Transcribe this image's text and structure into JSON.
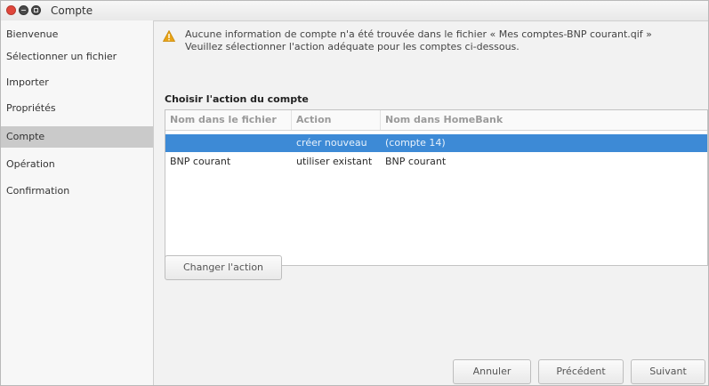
{
  "window": {
    "title": "Compte"
  },
  "sidebar": {
    "items": [
      {
        "label": "Bienvenue",
        "active": false
      },
      {
        "label": "Sélectionner un fichier",
        "active": false
      },
      {
        "label": "Importer",
        "active": false
      },
      {
        "label": "Propriétés",
        "active": false
      },
      {
        "label": "Compte",
        "active": true
      },
      {
        "label": "Opération",
        "active": false
      },
      {
        "label": "Confirmation",
        "active": false
      }
    ]
  },
  "warning": {
    "icon": "warning-icon",
    "line1": "Aucune information de compte n'a été trouvée dans le fichier « Mes comptes-BNP courant.qif »",
    "line2": "Veuillez sélectionner l'action adéquate pour les comptes ci-dessous."
  },
  "section": {
    "title": "Choisir l'action du compte"
  },
  "table": {
    "columns": [
      "Nom dans le fichier",
      "Action",
      "Nom dans HomeBank"
    ],
    "rows": [
      {
        "name": "",
        "action": "créer nouveau",
        "homebank": "(compte 14)",
        "selected": true
      },
      {
        "name": "BNP courant",
        "action": "utiliser existant",
        "homebank": "BNP courant",
        "selected": false
      }
    ]
  },
  "buttons": {
    "change_action": "Changer l'action",
    "cancel": "Annuler",
    "previous": "Précédent",
    "next": "Suivant"
  },
  "colors": {
    "selection": "#3d8ad6",
    "warning": "#e8a317",
    "close": "#e0463b"
  }
}
